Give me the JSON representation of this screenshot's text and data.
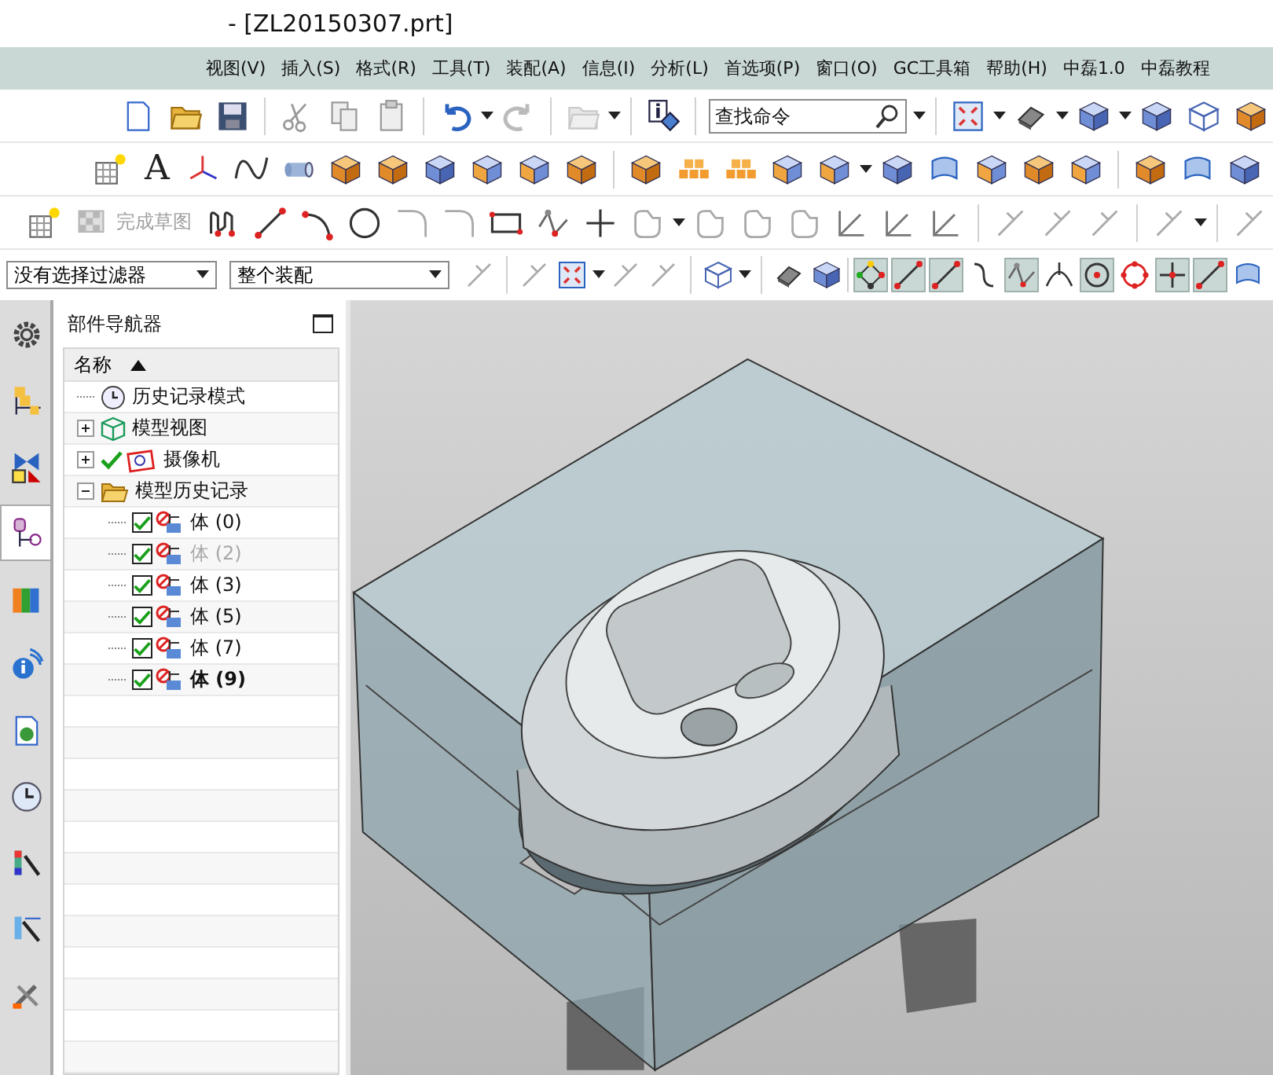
{
  "window": {
    "title": "- [ZL20150307.prt]"
  },
  "menu": [
    "视图(V)",
    "插入(S)",
    "格式(R)",
    "工具(T)",
    "装配(A)",
    "信息(I)",
    "分析(L)",
    "首选项(P)",
    "窗口(O)",
    "GC工具箱",
    "帮助(H)",
    "中磊1.0",
    "中磊教程"
  ],
  "toolbar": {
    "search_placeholder": "查找命令",
    "text_tool": "A",
    "finish_sketch": "完成草图",
    "selection_filter": "没有选择过滤器",
    "assembly_scope": "整个装配",
    "snap_buttons": [
      {
        "on": true
      },
      {
        "on": true
      },
      {
        "on": true
      },
      {
        "on": false
      },
      {
        "on": true
      },
      {
        "on": false
      },
      {
        "on": true
      },
      {
        "on": false
      },
      {
        "on": true
      },
      {
        "on": true
      },
      {
        "on": false
      }
    ]
  },
  "resource_tabs": [
    {
      "selected": false
    },
    {
      "selected": false
    },
    {
      "selected": false
    },
    {
      "selected": true
    },
    {
      "selected": false
    },
    {
      "selected": false
    },
    {
      "selected": false
    },
    {
      "selected": false
    },
    {
      "selected": false
    },
    {
      "selected": false
    },
    {
      "selected": false
    }
  ],
  "navigator": {
    "title": "部件导航器",
    "column": "名称",
    "items": [
      {
        "kind": "history",
        "label": "历史记录模式"
      },
      {
        "kind": "view",
        "label": "模型视图",
        "expanded": false
      },
      {
        "kind": "camera",
        "label": "摄像机",
        "expanded": false,
        "checked": true
      },
      {
        "kind": "folder",
        "label": "模型历史记录",
        "expanded": true,
        "children": [
          {
            "label": "体 (0)",
            "checked": true,
            "dimmed": false,
            "current": false
          },
          {
            "label": "体 (2)",
            "checked": true,
            "dimmed": true,
            "current": false
          },
          {
            "label": "体 (3)",
            "checked": true,
            "dimmed": false,
            "current": false
          },
          {
            "label": "体 (5)",
            "checked": true,
            "dimmed": false,
            "current": false
          },
          {
            "label": "体 (7)",
            "checked": true,
            "dimmed": false,
            "current": false
          },
          {
            "label": "体 (9)",
            "checked": true,
            "dimmed": false,
            "current": true
          }
        ]
      }
    ]
  }
}
